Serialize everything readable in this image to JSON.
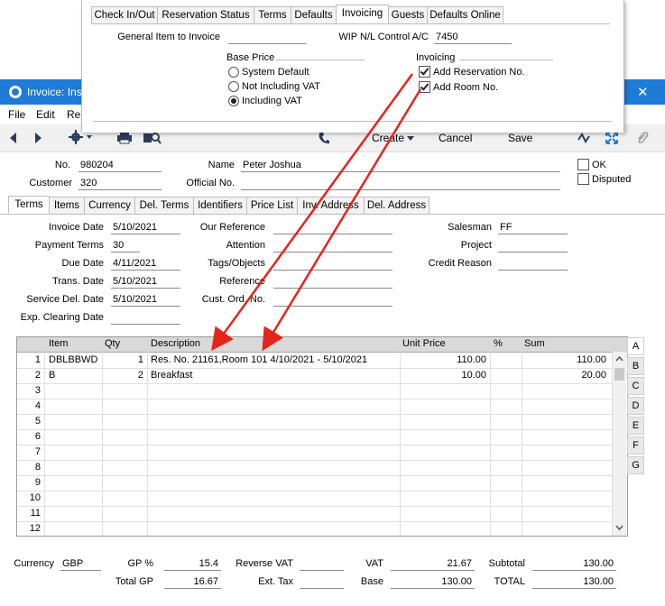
{
  "dialog": {
    "tabs": [
      "Check In/Out",
      "Reservation Status",
      "Terms",
      "Defaults",
      "Invoicing",
      "Guests",
      "Defaults Online"
    ],
    "active_tab": "Invoicing",
    "general_item_label": "General Item to Invoice",
    "general_item_value": "",
    "wip_label": "WIP N/L Control A/C",
    "wip_value": "7450",
    "base_price_label": "Base Price",
    "base_price_options": [
      {
        "label": "System Default",
        "selected": false
      },
      {
        "label": "Not Including VAT",
        "selected": false
      },
      {
        "label": "Including VAT",
        "selected": true
      }
    ],
    "invoicing_label": "Invoicing",
    "invoicing_options": [
      {
        "label": "Add Reservation No.",
        "checked": true
      },
      {
        "label": "Add Room No.",
        "checked": true
      }
    ]
  },
  "window": {
    "title": "Invoice: Ins",
    "close_glyph": "✕",
    "accent": "#1e7bd6"
  },
  "menu": [
    "File",
    "Edit",
    "Re"
  ],
  "toolbar": {
    "create_label": "Create",
    "cancel_label": "Cancel",
    "save_label": "Save"
  },
  "header": {
    "no_label": "No.",
    "no_value": "980204",
    "name_label": "Name",
    "name_value": "Peter Joshua",
    "customer_label": "Customer",
    "customer_value": "320",
    "official_no_label": "Official No.",
    "official_no_value": "",
    "ok_label": "OK",
    "disputed_label": "Disputed"
  },
  "tabs": [
    "Terms",
    "Items",
    "Currency",
    "Del. Terms",
    "Identifiers",
    "Price List",
    "Inv. Address",
    "Del. Address"
  ],
  "active_tab": "Terms",
  "terms": {
    "invoice_date_label": "Invoice Date",
    "invoice_date": "5/10/2021",
    "payment_terms_label": "Payment Terms",
    "payment_terms": "30",
    "due_date_label": "Due Date",
    "due_date": "4/11/2021",
    "trans_date_label": "Trans. Date",
    "trans_date": "5/10/2021",
    "service_del_date_label": "Service Del. Date",
    "service_del_date": "5/10/2021",
    "exp_clearing_label": "Exp. Clearing Date",
    "exp_clearing": "",
    "our_reference_label": "Our Reference",
    "attention_label": "Attention",
    "tags_label": "Tags/Objects",
    "reference_label": "Reference",
    "cust_ord_label": "Cust. Ord. No.",
    "salesman_label": "Salesman",
    "salesman": "FF",
    "project_label": "Project",
    "project": "",
    "credit_reason_label": "Credit Reason",
    "credit_reason": ""
  },
  "grid": {
    "columns": [
      "Item",
      "Qty",
      "Description",
      "Unit Price",
      "%",
      "Sum"
    ],
    "rows": [
      {
        "n": "1",
        "item": "DBLBBWD",
        "qty": "1",
        "desc": "Res. No. 21161,Room 101 4/10/2021 - 5/10/2021",
        "price": "110.00",
        "pct": "",
        "sum": "110.00"
      },
      {
        "n": "2",
        "item": "B",
        "qty": "2",
        "desc": "Breakfast",
        "price": "10.00",
        "pct": "",
        "sum": "20.00"
      },
      {
        "n": "3",
        "item": "",
        "qty": "",
        "desc": "",
        "price": "",
        "pct": "",
        "sum": ""
      },
      {
        "n": "4",
        "item": "",
        "qty": "",
        "desc": "",
        "price": "",
        "pct": "",
        "sum": ""
      },
      {
        "n": "5",
        "item": "",
        "qty": "",
        "desc": "",
        "price": "",
        "pct": "",
        "sum": ""
      },
      {
        "n": "6",
        "item": "",
        "qty": "",
        "desc": "",
        "price": "",
        "pct": "",
        "sum": ""
      },
      {
        "n": "7",
        "item": "",
        "qty": "",
        "desc": "",
        "price": "",
        "pct": "",
        "sum": ""
      },
      {
        "n": "8",
        "item": "",
        "qty": "",
        "desc": "",
        "price": "",
        "pct": "",
        "sum": ""
      },
      {
        "n": "9",
        "item": "",
        "qty": "",
        "desc": "",
        "price": "",
        "pct": "",
        "sum": ""
      },
      {
        "n": "10",
        "item": "",
        "qty": "",
        "desc": "",
        "price": "",
        "pct": "",
        "sum": ""
      },
      {
        "n": "11",
        "item": "",
        "qty": "",
        "desc": "",
        "price": "",
        "pct": "",
        "sum": ""
      },
      {
        "n": "12",
        "item": "",
        "qty": "",
        "desc": "",
        "price": "",
        "pct": "",
        "sum": ""
      }
    ],
    "side_tabs": [
      "A",
      "B",
      "C",
      "D",
      "E",
      "F",
      "G"
    ]
  },
  "footer": {
    "currency_label": "Currency",
    "currency": "GBP",
    "gp_pct_label": "GP %",
    "gp_pct": "15.4",
    "reverse_vat_label": "Reverse VAT",
    "reverse_vat": "",
    "vat_label": "VAT",
    "vat": "21.67",
    "subtotal_label": "Subtotal",
    "subtotal": "130.00",
    "total_gp_label": "Total GP",
    "total_gp": "16.67",
    "ext_tax_label": "Ext. Tax",
    "ext_tax": "",
    "base_label": "Base",
    "base": "130.00",
    "total_label": "TOTAL",
    "total": "130.00"
  },
  "arrow_color": "#e8231b"
}
